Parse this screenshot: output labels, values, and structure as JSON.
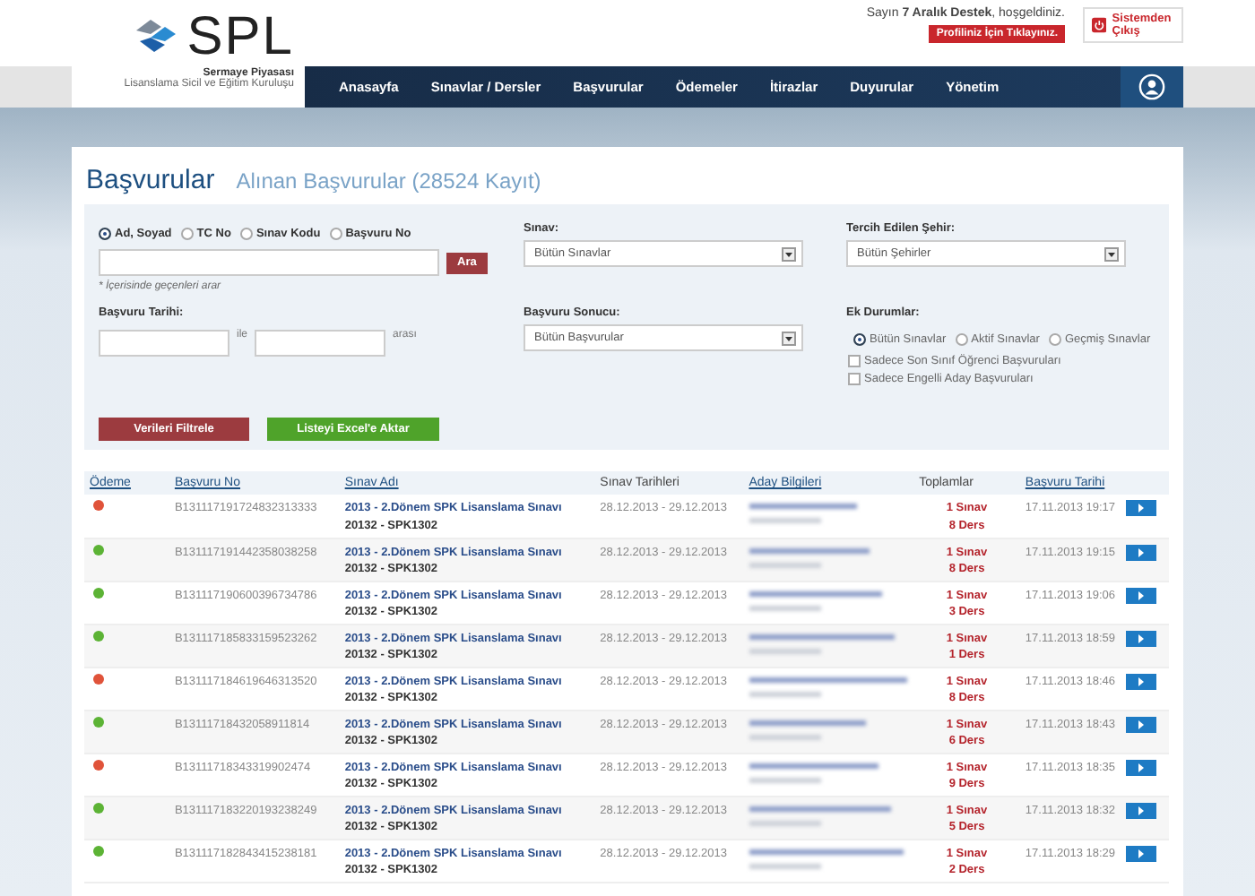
{
  "header": {
    "logo": {
      "text": "SPL",
      "subtitle_1": "Sermaye Piyasası",
      "subtitle_2": "Lisanslama Sicil ve Eğitim Kuruluşu"
    },
    "greeting": "Sayın **7 Aralık Destek**, hoşgeldiniz.",
    "profile_button": "Profiliniz İçin Tıklayınız.",
    "logout_button": "Sistemden Çıkış"
  },
  "nav": [
    "Anasayfa",
    "Sınavlar / Dersler",
    "Başvurular",
    "Ödemeler",
    "İtirazlar",
    "Duyurular",
    "Yönetim"
  ],
  "page": {
    "title": "Başvurular",
    "subtitle": "Alınan Başvurular (28524 Kayıt)"
  },
  "filters": {
    "search_modes": [
      {
        "label": "Ad, Soyad",
        "selected": true
      },
      {
        "label": "TC No",
        "selected": false
      },
      {
        "label": "Sınav Kodu",
        "selected": false
      },
      {
        "label": "Başvuru No",
        "selected": false
      }
    ],
    "search_button": "Ara",
    "hint": "* İçerisinde geçenleri arar",
    "date_label": "Başvuru Tarihi:",
    "date_between": "ile",
    "date_after": "arası",
    "exam_label": "Sınav:",
    "exam_value": "Bütün Sınavlar",
    "result_label": "Başvuru Sonucu:",
    "result_value": "Bütün Başvurular",
    "city_label": "Tercih Edilen Şehir:",
    "city_value": "Bütün Şehirler",
    "extra_label": "Ek Durumlar:",
    "extra_modes": [
      {
        "label": "Bütün Sınavlar",
        "selected": true
      },
      {
        "label": "Aktif Sınavlar",
        "selected": false
      },
      {
        "label": "Geçmiş Sınavlar",
        "selected": false
      }
    ],
    "checkboxes": [
      {
        "label": "Sadece Son Sınıf Öğrenci Başvuruları",
        "checked": false
      },
      {
        "label": "Sadece Engelli Aday Başvuruları",
        "checked": false
      }
    ],
    "filter_button": "Verileri Filtrele",
    "export_button": "Listeyi Excel'e Aktar"
  },
  "table": {
    "columns": [
      {
        "label": "Ödeme",
        "sortable": true
      },
      {
        "label": "Başvuru No",
        "sortable": true
      },
      {
        "label": "Sınav Adı",
        "sortable": true
      },
      {
        "label": "Sınav Tarihleri",
        "sortable": false
      },
      {
        "label": "Aday Bilgileri",
        "sortable": true
      },
      {
        "label": "Toplamlar",
        "sortable": false
      },
      {
        "label": "Başvuru Tarihi",
        "sortable": true
      }
    ],
    "rows": [
      {
        "color": "#e0533a",
        "application_no": "B131117191724832313333",
        "exam_name": "2013 - 2.Dönem SPK Lisanslama Sınavı",
        "exam_code": "20132 - SPK1302",
        "exam_dates": "28.12.2013 - 29.12.2013",
        "total_exams": "1 Sınav",
        "total_lessons": "8 Ders",
        "application_date": "17.11.2013 19:17"
      },
      {
        "color": "#5cb335",
        "application_no": "B131117191442358038258",
        "exam_name": "2013 - 2.Dönem SPK Lisanslama Sınavı",
        "exam_code": "20132 - SPK1302",
        "exam_dates": "28.12.2013 - 29.12.2013",
        "total_exams": "1 Sınav",
        "total_lessons": "8 Ders",
        "application_date": "17.11.2013 19:15"
      },
      {
        "color": "#5cb335",
        "application_no": "B131117190600396734786",
        "exam_name": "2013 - 2.Dönem SPK Lisanslama Sınavı",
        "exam_code": "20132 - SPK1302",
        "exam_dates": "28.12.2013 - 29.12.2013",
        "total_exams": "1 Sınav",
        "total_lessons": "3 Ders",
        "application_date": "17.11.2013 19:06"
      },
      {
        "color": "#5cb335",
        "application_no": "B131117185833159523262",
        "exam_name": "2013 - 2.Dönem SPK Lisanslama Sınavı",
        "exam_code": "20132 - SPK1302",
        "exam_dates": "28.12.2013 - 29.12.2013",
        "total_exams": "1 Sınav",
        "total_lessons": "1 Ders",
        "application_date": "17.11.2013 18:59"
      },
      {
        "color": "#e0533a",
        "application_no": "B131117184619646313520",
        "exam_name": "2013 - 2.Dönem SPK Lisanslama Sınavı",
        "exam_code": "20132 - SPK1302",
        "exam_dates": "28.12.2013 - 29.12.2013",
        "total_exams": "1 Sınav",
        "total_lessons": "8 Ders",
        "application_date": "17.11.2013 18:46"
      },
      {
        "color": "#5cb335",
        "application_no": "B13111718432058911814",
        "exam_name": "2013 - 2.Dönem SPK Lisanslama Sınavı",
        "exam_code": "20132 - SPK1302",
        "exam_dates": "28.12.2013 - 29.12.2013",
        "total_exams": "1 Sınav",
        "total_lessons": "6 Ders",
        "application_date": "17.11.2013 18:43"
      },
      {
        "color": "#e0533a",
        "application_no": "B13111718343319902474",
        "exam_name": "2013 - 2.Dönem SPK Lisanslama Sınavı",
        "exam_code": "20132 - SPK1302",
        "exam_dates": "28.12.2013 - 29.12.2013",
        "total_exams": "1 Sınav",
        "total_lessons": "9 Ders",
        "application_date": "17.11.2013 18:35"
      },
      {
        "color": "#5cb335",
        "application_no": "B131117183220193238249",
        "exam_name": "2013 - 2.Dönem SPK Lisanslama Sınavı",
        "exam_code": "20132 - SPK1302",
        "exam_dates": "28.12.2013 - 29.12.2013",
        "total_exams": "1 Sınav",
        "total_lessons": "5 Ders",
        "application_date": "17.11.2013 18:32"
      },
      {
        "color": "#5cb335",
        "application_no": "B131117182843415238181",
        "exam_name": "2013 - 2.Dönem SPK Lisanslama Sınavı",
        "exam_code": "20132 - SPK1302",
        "exam_dates": "28.12.2013 - 29.12.2013",
        "total_exams": "1 Sınav",
        "total_lessons": "2 Ders",
        "application_date": "17.11.2013 18:29"
      }
    ]
  }
}
